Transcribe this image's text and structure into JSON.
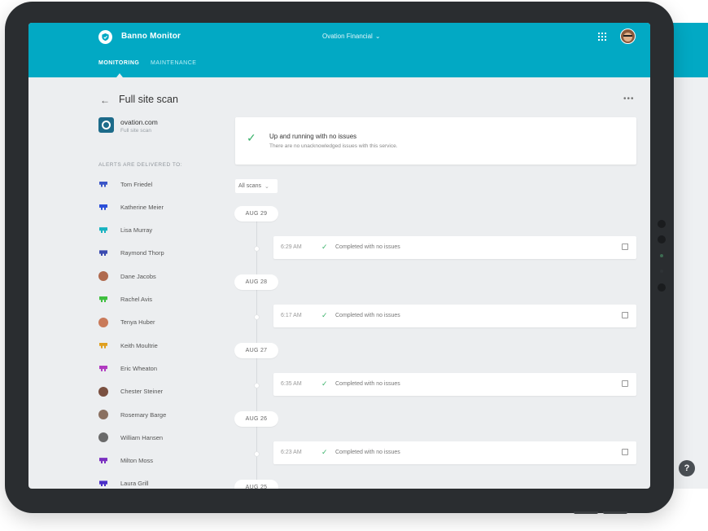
{
  "app": {
    "title": "Banno Monitor",
    "organization": "Ovation Financial"
  },
  "nav": {
    "tabs": [
      {
        "label": "MONITORING"
      },
      {
        "label": "MAINTENANCE"
      }
    ]
  },
  "page": {
    "title": "Full site scan"
  },
  "site": {
    "name": "ovation.com",
    "subtitle": "Full site scan"
  },
  "alerts": {
    "heading": "ALERTS ARE DELIVERED TO:",
    "people": [
      {
        "name": "Tom Friedel",
        "icon": "pixel-avatar",
        "color": "#3a55c7"
      },
      {
        "name": "Katherine Meier",
        "icon": "pixel-avatar",
        "color": "#2b4fd8"
      },
      {
        "name": "Lisa Murray",
        "icon": "pixel-avatar",
        "color": "#17b2c0"
      },
      {
        "name": "Raymond Thorp",
        "icon": "pixel-avatar",
        "color": "#3a4ab0"
      },
      {
        "name": "Dane Jacobs",
        "icon": "photo-avatar",
        "color": "#b06a4e"
      },
      {
        "name": "Rachel Avis",
        "icon": "pixel-avatar",
        "color": "#3fbf3f"
      },
      {
        "name": "Tenya Huber",
        "icon": "photo-avatar",
        "color": "#c97a5a"
      },
      {
        "name": "Keith Moultrie",
        "icon": "pixel-avatar",
        "color": "#e0a020"
      },
      {
        "name": "Eric Wheaton",
        "icon": "pixel-avatar",
        "color": "#b03ac0"
      },
      {
        "name": "Chester Steiner",
        "icon": "photo-avatar",
        "color": "#7a5040"
      },
      {
        "name": "Rosemary Barge",
        "icon": "photo-avatar",
        "color": "#8a7060"
      },
      {
        "name": "William Hansen",
        "icon": "photo-avatar",
        "color": "#6a6a6a"
      },
      {
        "name": "Milton Moss",
        "icon": "pixel-avatar",
        "color": "#7a2fc0"
      },
      {
        "name": "Laura Grill",
        "icon": "pixel-avatar",
        "color": "#4a2fc8"
      }
    ]
  },
  "status": {
    "title": "Up and running with no issues",
    "subtitle": "There are no unacknowledged issues with this service."
  },
  "filter": {
    "label": "All scans"
  },
  "scans": [
    {
      "date": "AUG 29",
      "time": "6:29 AM",
      "result": "Completed with no issues"
    },
    {
      "date": "AUG 28",
      "time": "6:17 AM",
      "result": "Completed with no issues"
    },
    {
      "date": "AUG 27",
      "time": "6:35 AM",
      "result": "Completed with no issues"
    },
    {
      "date": "AUG 26",
      "time": "6:23 AM",
      "result": "Completed with no issues"
    },
    {
      "date": "AUG 25"
    }
  ],
  "help": {
    "label": "?"
  },
  "colors": {
    "brand": "#02a9c4",
    "success": "#3bb36b",
    "background": "#eceef0"
  }
}
